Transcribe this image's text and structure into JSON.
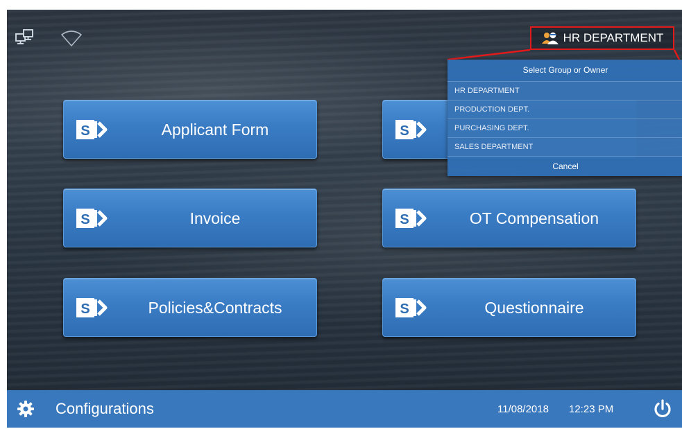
{
  "header": {
    "network_icon": "network-computers-icon",
    "wifi_icon": "wifi-icon",
    "group_button": {
      "label": "HR DEPARTMENT",
      "icon": "people-icon",
      "border_color": "#e21a1a"
    }
  },
  "dropdown": {
    "title": "Select Group or Owner",
    "items": [
      {
        "label": "HR DEPARTMENT"
      },
      {
        "label": "PRODUCTION DEPT."
      },
      {
        "label": "PURCHASING DEPT."
      },
      {
        "label": "SALES DEPARTMENT"
      }
    ],
    "cancel_label": "Cancel"
  },
  "tiles": [
    {
      "label": "Applicant Form",
      "icon": "sharepoint-icon"
    },
    {
      "label": "",
      "icon": "sharepoint-icon"
    },
    {
      "label": "Invoice",
      "icon": "sharepoint-icon"
    },
    {
      "label": "OT Compensation",
      "icon": "sharepoint-icon"
    },
    {
      "label": "Policies&Contracts",
      "icon": "sharepoint-icon"
    },
    {
      "label": "Questionnaire",
      "icon": "sharepoint-icon"
    }
  ],
  "footer": {
    "settings_icon": "gear-icon",
    "config_label": "Configurations",
    "date": "11/08/2018",
    "time": "12:23 PM",
    "power_icon": "power-icon"
  },
  "colors": {
    "tile_blue": "#3a7cc4",
    "bar_blue": "#3a78bd",
    "highlight_red": "#e21a1a"
  }
}
